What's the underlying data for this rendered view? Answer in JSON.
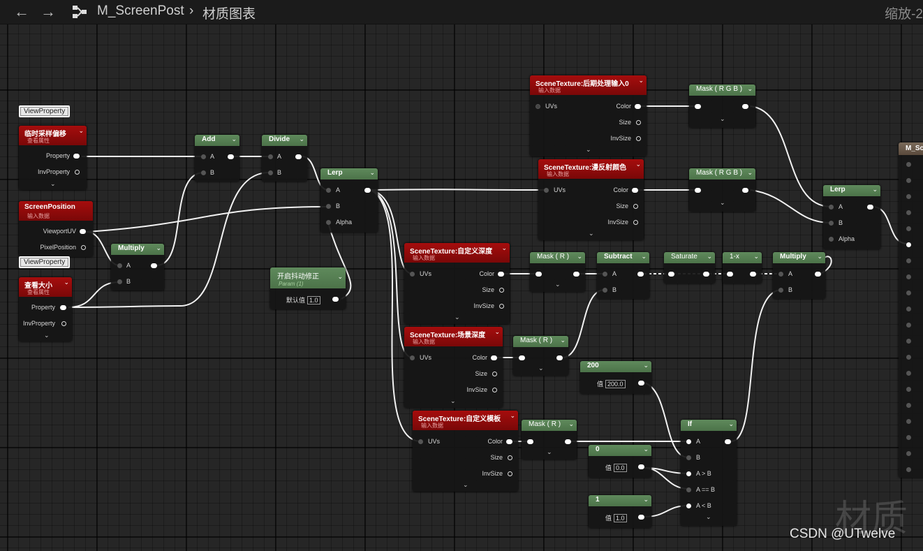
{
  "toolbar": {
    "back_icon": "←",
    "forward_icon": "→",
    "graph_icon": "graph-icon",
    "asset_name": "M_ScreenPost",
    "separator": "›",
    "graph_name": "材质图表",
    "zoom": "缩放-2"
  },
  "badges": {
    "view_property_1": "ViewProperty",
    "view_property_2": "ViewProperty"
  },
  "nodes": {
    "vp1": {
      "title": "临时采样偏移",
      "subtitle": "查看属性",
      "pins": [
        "Property",
        "InvProperty"
      ]
    },
    "screenpos": {
      "title": "ScreenPosition",
      "subtitle": "输入数据",
      "pins": [
        "ViewportUV",
        "PixelPosition"
      ]
    },
    "vp2": {
      "title": "查看大小",
      "subtitle": "查看属性",
      "pins": [
        "Property",
        "InvProperty"
      ]
    },
    "multiply1": {
      "title": "Multiply",
      "pins": [
        "A",
        "B"
      ]
    },
    "add": {
      "title": "Add",
      "pins": [
        "A",
        "B"
      ]
    },
    "divide": {
      "title": "Divide",
      "pins": [
        "A",
        "B"
      ]
    },
    "lerp1": {
      "title": "Lerp",
      "pins": [
        "A",
        "B",
        "Alpha"
      ]
    },
    "param": {
      "title": "开启抖动修正",
      "subtitle": "Param (1)",
      "default_label": "默认值",
      "default_value": "1.0"
    },
    "st_post": {
      "title": "SceneTexture:后期处理输入0",
      "subtitle": "输入数据",
      "pins": [
        "UVs",
        "Color",
        "Size",
        "InvSize"
      ]
    },
    "st_diffuse": {
      "title": "SceneTexture:漫反射颜色",
      "subtitle": "输入数据",
      "pins": [
        "UVs",
        "Color",
        "Size",
        "InvSize"
      ]
    },
    "st_cdepth": {
      "title": "SceneTexture:自定义深度",
      "subtitle": "输入数据",
      "pins": [
        "UVs",
        "Color",
        "Size",
        "InvSize"
      ]
    },
    "st_sdepth": {
      "title": "SceneTexture:场景深度",
      "subtitle": "输入数据",
      "pins": [
        "UVs",
        "Color",
        "Size",
        "InvSize"
      ]
    },
    "st_stencil": {
      "title": "SceneTexture:自定义模板",
      "subtitle": "输入数据",
      "pins": [
        "UVs",
        "Color",
        "Size",
        "InvSize"
      ]
    },
    "mask_rgb1": {
      "title": "Mask ( R G B )"
    },
    "mask_rgb2": {
      "title": "Mask ( R G B )"
    },
    "mask_r1": {
      "title": "Mask ( R )"
    },
    "mask_r2": {
      "title": "Mask ( R )"
    },
    "mask_r3": {
      "title": "Mask ( R )"
    },
    "subtract": {
      "title": "Subtract",
      "pins": [
        "A",
        "B"
      ]
    },
    "saturate": {
      "title": "Saturate"
    },
    "oneminus": {
      "title": "1-x"
    },
    "multiply2": {
      "title": "Multiply",
      "pins": [
        "A",
        "B"
      ]
    },
    "lerp2": {
      "title": "Lerp",
      "pins": [
        "A",
        "B",
        "Alpha"
      ]
    },
    "c200": {
      "title": "200",
      "label": "值",
      "value": "200.0"
    },
    "c0": {
      "title": "0",
      "label": "值",
      "value": "0.0"
    },
    "c1": {
      "title": "1",
      "label": "值",
      "value": "1.0"
    },
    "if": {
      "title": "If",
      "pins": [
        "A",
        "B",
        "A > B",
        "A == B",
        "A < B"
      ]
    },
    "matnode": {
      "title": "M_Sc"
    }
  },
  "watermark": "材质",
  "credit": "CSDN @UTwelve"
}
